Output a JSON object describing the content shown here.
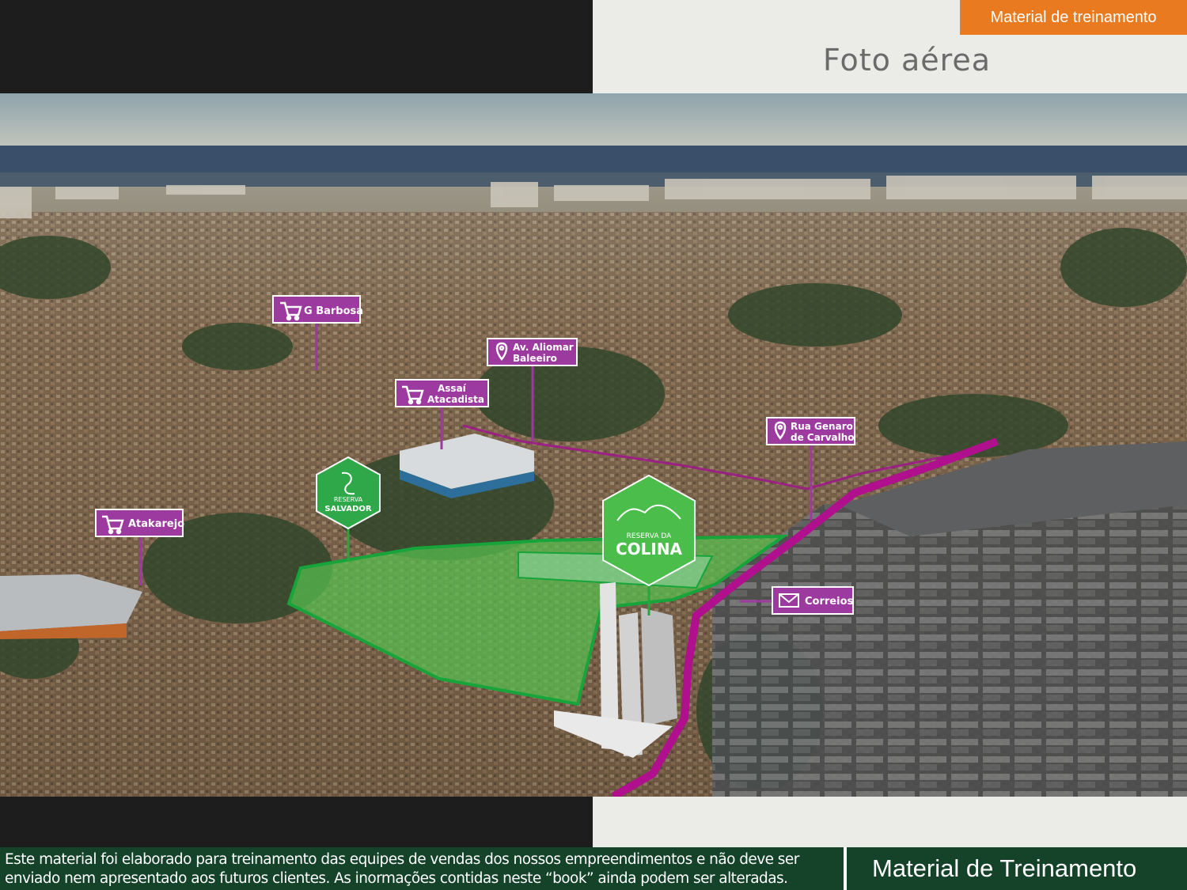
{
  "header": {
    "badge": "Material de treinamento",
    "title": "Foto aérea"
  },
  "map": {
    "callouts": {
      "g_barbosa": "G Barbosa",
      "aliomar_line1": "Av. Aliomar",
      "aliomar_line2": "Baleeiro",
      "assai_line1": "Assaí",
      "assai_line2": "Atacadista",
      "genaro_line1": "Rua Genaro",
      "genaro_line2": "de Carvalho",
      "atakarejo": "Atakarejo",
      "correios": "Correios"
    },
    "logos": {
      "salvador_line1": "RESERVA",
      "salvador_line2": "SALVADOR",
      "colina_line1": "RESERVA DA",
      "colina_line2": "COLINA"
    },
    "icons": {
      "cart": "shopping-cart-icon",
      "pin": "location-pin-icon",
      "mail": "mail-icon"
    },
    "colors": {
      "callout": "#9c3aa0",
      "route": "#b0108e",
      "area": "#4cc04c"
    }
  },
  "footer": {
    "disclaimer": "Este material foi elaborado para treinamento das equipes de vendas dos nossos empreendimentos e não deve ser enviado nem apresentado aos futuros clientes. As inormações contidas neste “book” ainda podem ser alteradas.",
    "label": "Material de Treinamento"
  }
}
